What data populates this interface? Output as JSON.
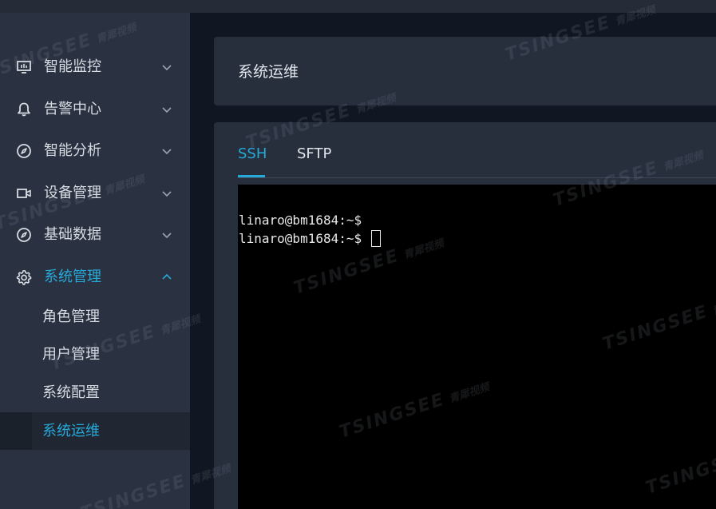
{
  "sidebar": {
    "menu": [
      {
        "label": "智能监控",
        "icon": "monitor-icon",
        "expanded": false
      },
      {
        "label": "告警中心",
        "icon": "bell-icon",
        "expanded": false
      },
      {
        "label": "智能分析",
        "icon": "compass-icon",
        "expanded": false
      },
      {
        "label": "设备管理",
        "icon": "video-camera-icon",
        "expanded": false
      },
      {
        "label": "基础数据",
        "icon": "compass-icon",
        "expanded": false
      },
      {
        "label": "系统管理",
        "icon": "gear-icon",
        "expanded": true
      }
    ],
    "submenu": [
      {
        "label": "角色管理",
        "selected": false
      },
      {
        "label": "用户管理",
        "selected": false
      },
      {
        "label": "系统配置",
        "selected": false
      },
      {
        "label": "系统运维",
        "selected": true
      }
    ]
  },
  "page": {
    "title": "系统运维"
  },
  "tabs": [
    {
      "label": "SSH",
      "active": true
    },
    {
      "label": "SFTP",
      "active": false
    }
  ],
  "terminal": {
    "lines": [
      "linaro@bm1684:~$",
      "linaro@bm1684:~$ "
    ]
  },
  "watermark": {
    "brand": "TSINGSEE",
    "brand_cn": "青犀视频"
  },
  "colors": {
    "accent": "#27a9d8",
    "sidebar_bg": "#2a3241",
    "card_bg": "#272f3d",
    "page_bg": "#111722",
    "terminal_bg": "#000000"
  }
}
